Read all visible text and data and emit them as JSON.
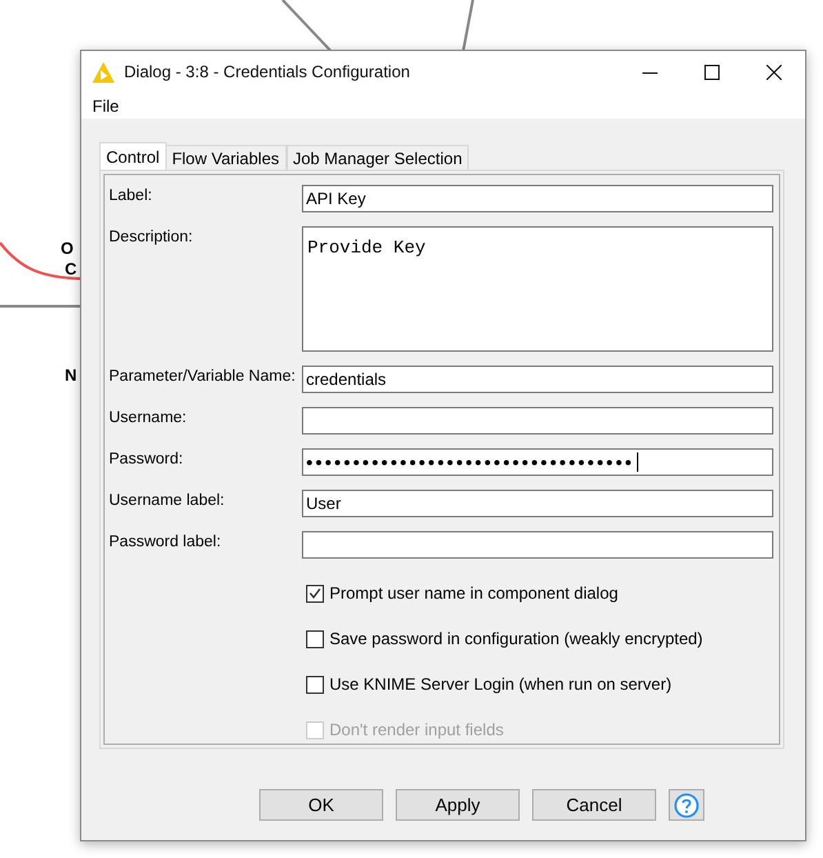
{
  "canvas": {
    "node_labels": [
      "O",
      "C",
      "N"
    ]
  },
  "window": {
    "title": "Dialog - 3:8 - Credentials Configuration"
  },
  "menu": [
    "File"
  ],
  "tabs": [
    {
      "label": "Control",
      "selected": true
    },
    {
      "label": "Flow Variables",
      "selected": false
    },
    {
      "label": "Job Manager Selection",
      "selected": false
    }
  ],
  "fields": [
    {
      "label": "Label:",
      "kind": "text",
      "value": "API Key"
    },
    {
      "label": "Description:",
      "kind": "area",
      "value": "Provide Key"
    },
    {
      "label": "Parameter/Variable Name:",
      "kind": "text",
      "value": "credentials"
    },
    {
      "label": "Username:",
      "kind": "text"
    },
    {
      "label": "Password:",
      "kind": "password",
      "value": "•••••••••••••••••••••••••••••••••••"
    },
    {
      "label": "Username label:",
      "kind": "text",
      "value": "User"
    },
    {
      "label": "Password label:",
      "kind": "text"
    }
  ],
  "options": [
    {
      "label": "Prompt user name in component dialog",
      "checked": true,
      "disabled": false
    },
    {
      "label": "Save password in configuration (weakly encrypted)",
      "checked": false,
      "disabled": false
    },
    {
      "label": "Use KNIME Server Login (when run on server)",
      "checked": false,
      "disabled": false
    },
    {
      "label": "Don't render input fields",
      "checked": false,
      "disabled": true
    }
  ],
  "buttons": [
    "OK",
    "Apply",
    "Cancel"
  ]
}
